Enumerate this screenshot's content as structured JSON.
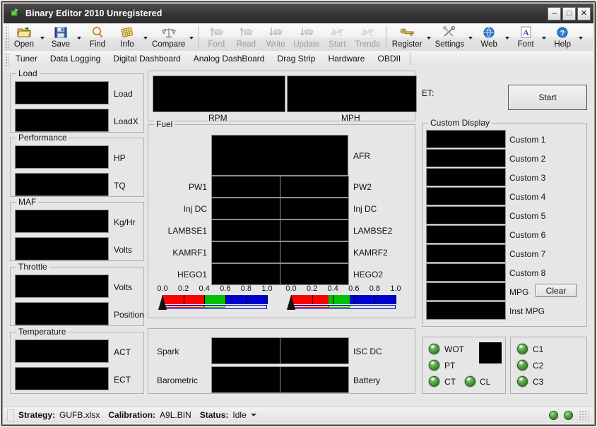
{
  "window": {
    "title": "Binary Editor 2010 Unregistered",
    "icon": "chip-icon",
    "minimize": "–",
    "maximize": "□",
    "close": "✕"
  },
  "toolbar": {
    "items": [
      {
        "label": "Open",
        "icon": "open-folder-icon",
        "enabled": true,
        "dropdown": true
      },
      {
        "label": "Save",
        "icon": "floppy-disk-icon",
        "enabled": true,
        "dropdown": true
      },
      {
        "label": "Find",
        "icon": "magnifier-icon",
        "enabled": true,
        "dropdown": false
      },
      {
        "label": "Info",
        "icon": "notes-icon",
        "enabled": true,
        "dropdown": true
      },
      {
        "label": "Compare",
        "icon": "scales-icon",
        "enabled": true,
        "dropdown": true
      },
      {
        "label": "Ford",
        "icon": "upload-car-icon",
        "enabled": false,
        "dropdown": false
      },
      {
        "label": "Read",
        "icon": "upload-car-icon",
        "enabled": false,
        "dropdown": false
      },
      {
        "label": "Write",
        "icon": "download-car-icon",
        "enabled": false,
        "dropdown": false
      },
      {
        "label": "Update",
        "icon": "download-car-icon",
        "enabled": false,
        "dropdown": false
      },
      {
        "label": "Start",
        "icon": "connector-icon",
        "enabled": false,
        "dropdown": false
      },
      {
        "label": "Trends",
        "icon": "connector-icon",
        "enabled": false,
        "dropdown": false
      },
      {
        "label": "Register",
        "icon": "key-icon",
        "enabled": true,
        "dropdown": true
      },
      {
        "label": "Settings",
        "icon": "tools-icon",
        "enabled": true,
        "dropdown": true
      },
      {
        "label": "Web",
        "icon": "globe-icon",
        "enabled": true,
        "dropdown": true
      },
      {
        "label": "Font",
        "icon": "font-a-icon",
        "enabled": true,
        "dropdown": true
      },
      {
        "label": "Help",
        "icon": "question-icon",
        "enabled": true,
        "dropdown": true
      }
    ]
  },
  "tabs": [
    {
      "label": "Tuner"
    },
    {
      "label": "Data Logging"
    },
    {
      "label": "Digital Dashboard"
    },
    {
      "label": "Analog DashBoard"
    },
    {
      "label": "Drag Strip"
    },
    {
      "label": "Hardware"
    },
    {
      "label": "OBDII"
    }
  ],
  "left_column": {
    "groups": [
      {
        "title": "Load",
        "rows": [
          {
            "label": "Load",
            "value": ""
          },
          {
            "label": "LoadX",
            "value": ""
          }
        ]
      },
      {
        "title": "Performance",
        "rows": [
          {
            "label": "HP",
            "value": ""
          },
          {
            "label": "TQ",
            "value": ""
          }
        ]
      },
      {
        "title": "MAF",
        "rows": [
          {
            "label": "Kg/Hr",
            "value": ""
          },
          {
            "label": "Volts",
            "value": ""
          }
        ]
      },
      {
        "title": "Throttle",
        "rows": [
          {
            "label": "Volts",
            "value": ""
          },
          {
            "label": "Position",
            "value": ""
          }
        ]
      },
      {
        "title": "Temperature",
        "rows": [
          {
            "label": "ACT",
            "value": ""
          },
          {
            "label": "ECT",
            "value": ""
          }
        ]
      }
    ]
  },
  "speed_panel": {
    "fields": [
      {
        "label": "RPM",
        "value": ""
      },
      {
        "label": "MPH",
        "value": ""
      }
    ]
  },
  "fuel_panel": {
    "title": "Fuel",
    "afr": {
      "label": "AFR",
      "value": ""
    },
    "rows": [
      {
        "left_label": "PW1",
        "left_value": "",
        "right_label": "PW2",
        "right_value": ""
      },
      {
        "left_label": "Inj DC",
        "left_value": "",
        "right_label": "Inj DC",
        "right_value": ""
      },
      {
        "left_label": "LAMBSE1",
        "left_value": "",
        "right_label": "LAMBSE2",
        "right_value": ""
      },
      {
        "left_label": "KAMRF1",
        "left_value": "",
        "right_label": "KAMRF2",
        "right_value": ""
      },
      {
        "left_label": "HEGO1",
        "left_value": "",
        "right_label": "HEGO2",
        "right_value": ""
      }
    ]
  },
  "gauges": {
    "tick_labels": [
      "0.0",
      "0.2",
      "0.4",
      "0.6",
      "0.8",
      "1.0"
    ],
    "colors": {
      "low": "#ff0000",
      "mid": "#00c000",
      "high": "#0000cc"
    },
    "bank1": {
      "value": 0.0,
      "red_to": 0.4,
      "green_to": 0.6,
      "blue_to": 1.0
    },
    "bank2": {
      "value": 0.0,
      "red_to": 0.36,
      "green_to": 0.56,
      "blue_to": 1.0
    }
  },
  "engine_panel": {
    "rows": [
      {
        "left_label": "Spark",
        "left_value": "",
        "right_label": "ISC DC",
        "right_value": ""
      },
      {
        "left_label": "Barometric",
        "left_value": "",
        "right_label": "Battery",
        "right_value": ""
      }
    ]
  },
  "right_column": {
    "et_label": "ET:",
    "et_value": "",
    "start_button": "Start",
    "custom_display": {
      "title": "Custom Display",
      "rows": [
        {
          "label": "Custom 1",
          "value": ""
        },
        {
          "label": "Custom 2",
          "value": ""
        },
        {
          "label": "Custom 3",
          "value": ""
        },
        {
          "label": "Custom 4",
          "value": ""
        },
        {
          "label": "Custom 5",
          "value": ""
        },
        {
          "label": "Custom 6",
          "value": ""
        },
        {
          "label": "Custom 7",
          "value": ""
        },
        {
          "label": "Custom 8",
          "value": ""
        },
        {
          "label": "MPG",
          "value": "",
          "button": "Clear"
        },
        {
          "label": "Inst MPG",
          "value": ""
        }
      ],
      "clear_button": "Clear"
    },
    "status_leds_left": [
      {
        "label": "WOT",
        "on": true
      },
      {
        "label": "PT",
        "on": true
      },
      {
        "label": "CT",
        "on": true
      },
      {
        "label": "CL",
        "on": true
      }
    ],
    "status_leds_right": [
      {
        "label": "C1",
        "on": true
      },
      {
        "label": "C2",
        "on": true
      },
      {
        "label": "C3",
        "on": true
      }
    ]
  },
  "statusbar": {
    "strategy_key": "Strategy:",
    "strategy_value": "GUFB.xlsx",
    "calibration_key": "Calibration:",
    "calibration_value": "A9L.BIN",
    "status_key": "Status:",
    "status_value": "Idle"
  }
}
